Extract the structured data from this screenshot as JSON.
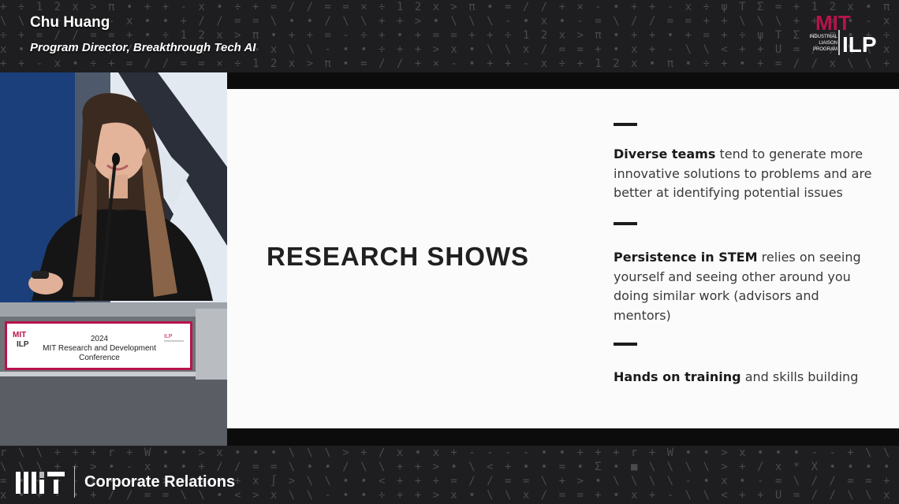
{
  "speaker": {
    "name": "Chu Huang",
    "title": "Program Director, Breakthrough Tech AI"
  },
  "logo": {
    "mit": "MIT",
    "ilp": "ILP",
    "line1": "INDUSTRIAL",
    "line2": "LIAISON",
    "line3": "PROGRAM"
  },
  "slide": {
    "heading": "RESEARCH SHOWS",
    "points": [
      {
        "bold": "Diverse teams",
        "rest": " tend to generate more innovative solutions to problems and are better at identifying potential issues"
      },
      {
        "bold": "Persistence in STEM",
        "rest": " relies on seeing yourself and seeing other around you doing similar work (advisors and mentors)"
      },
      {
        "bold": "Hands on training",
        "rest": " and skills building"
      }
    ]
  },
  "podium": {
    "year": "2024",
    "line1": "MIT Research and Development",
    "line2": "Conference"
  },
  "footer": {
    "brand": "Corporate Relations"
  },
  "colors": {
    "accent": "#b8134b",
    "background": "#1e1e20",
    "slide": "#fbfbfb"
  }
}
